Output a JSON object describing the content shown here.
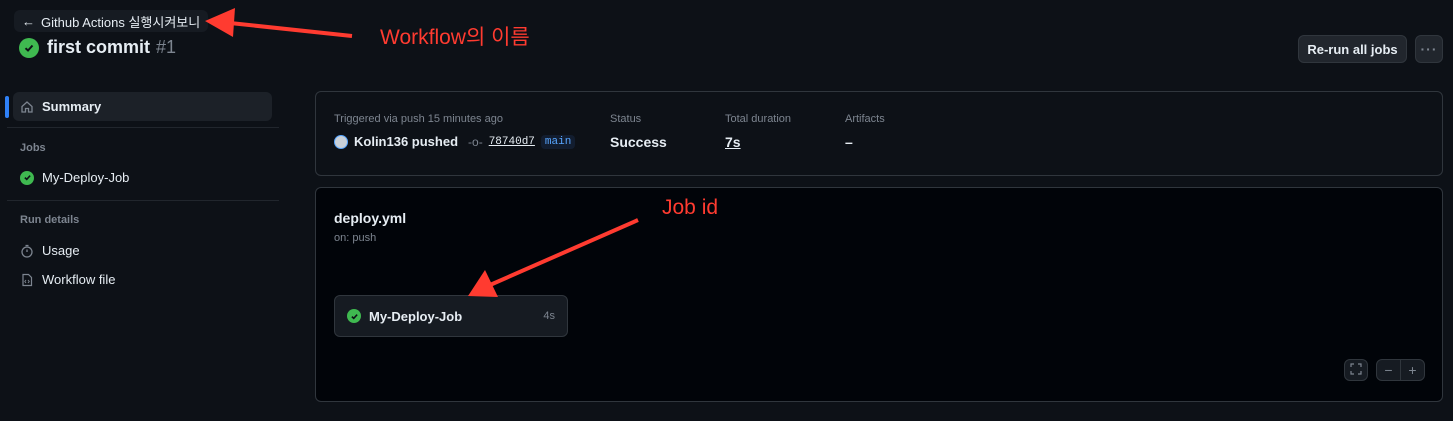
{
  "header": {
    "back_label": "Github Actions 실행시켜보니",
    "title": "first commit",
    "run_number": "#1",
    "rerun_label": "Re-run all jobs",
    "more_label": "···"
  },
  "sidebar": {
    "summary_label": "Summary",
    "jobs_heading": "Jobs",
    "job_label": "My-Deploy-Job",
    "run_details_heading": "Run details",
    "usage_label": "Usage",
    "workflow_file_label": "Workflow file"
  },
  "summary": {
    "trigger_label": "Triggered via push 15 minutes ago",
    "actor": "Kolin136 pushed",
    "commit_sha": "78740d7",
    "branch": "main",
    "status_label": "Status",
    "status_value": "Success",
    "duration_label": "Total duration",
    "duration_value": "7s",
    "artifacts_label": "Artifacts",
    "artifacts_value": "–"
  },
  "graph": {
    "workflow_file": "deploy.yml",
    "trigger": "on: push",
    "job_name": "My-Deploy-Job",
    "job_time": "4s"
  },
  "annotations": {
    "workflow_name": "Workflow의 이름",
    "job_id": "Job id",
    "color": "#ff3b30"
  },
  "colors": {
    "success": "#3fb950",
    "accent": "#2f81f7"
  }
}
